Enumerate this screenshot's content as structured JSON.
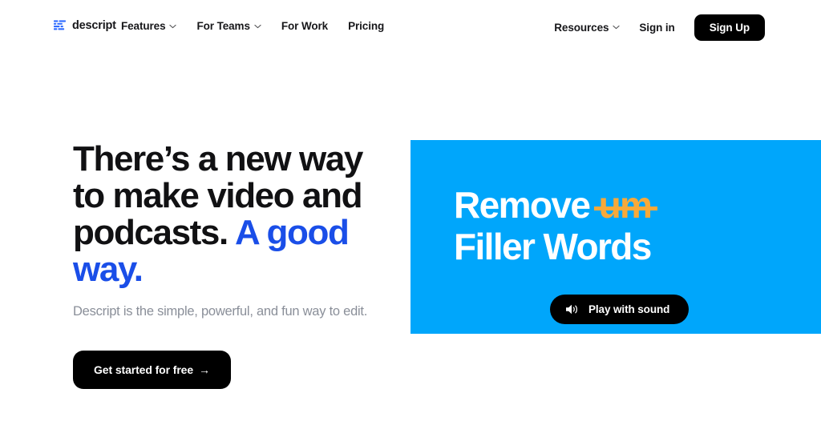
{
  "brand": {
    "name": "descript",
    "logo_icon": "descript-script-lines-logo",
    "logo_color": "#2f6bff"
  },
  "header": {
    "nav_left": [
      {
        "label": "Features",
        "has_dropdown": true,
        "icon": "chevron-down-icon"
      },
      {
        "label": "For Teams",
        "has_dropdown": true,
        "icon": "chevron-down-icon"
      },
      {
        "label": "For Work",
        "has_dropdown": false,
        "icon": ""
      },
      {
        "label": "Pricing",
        "has_dropdown": false,
        "icon": ""
      }
    ],
    "nav_right": {
      "resources_label": "Resources",
      "resources_icon": "chevron-down-icon",
      "signin_label": "Sign in",
      "signup_label": "Sign Up"
    }
  },
  "hero": {
    "headline_part1": "There’s a new way to make video and podcasts. ",
    "headline_accent": "A good way.",
    "headline_accent_color": "#1a4ee8",
    "subheadline": "Descript is the simple, powerful, and fun way to edit.",
    "cta_label": "Get started for free",
    "cta_arrow": "→"
  },
  "video_panel": {
    "background_color": "#00a6fb",
    "title_line1_prefix": "Remove ",
    "title_line1_struck": "um",
    "struck_color": "#f7a93a",
    "title_line2": "Filler Words",
    "play_button_label": "Play with sound",
    "play_button_icon": "speaker-sound-icon"
  }
}
